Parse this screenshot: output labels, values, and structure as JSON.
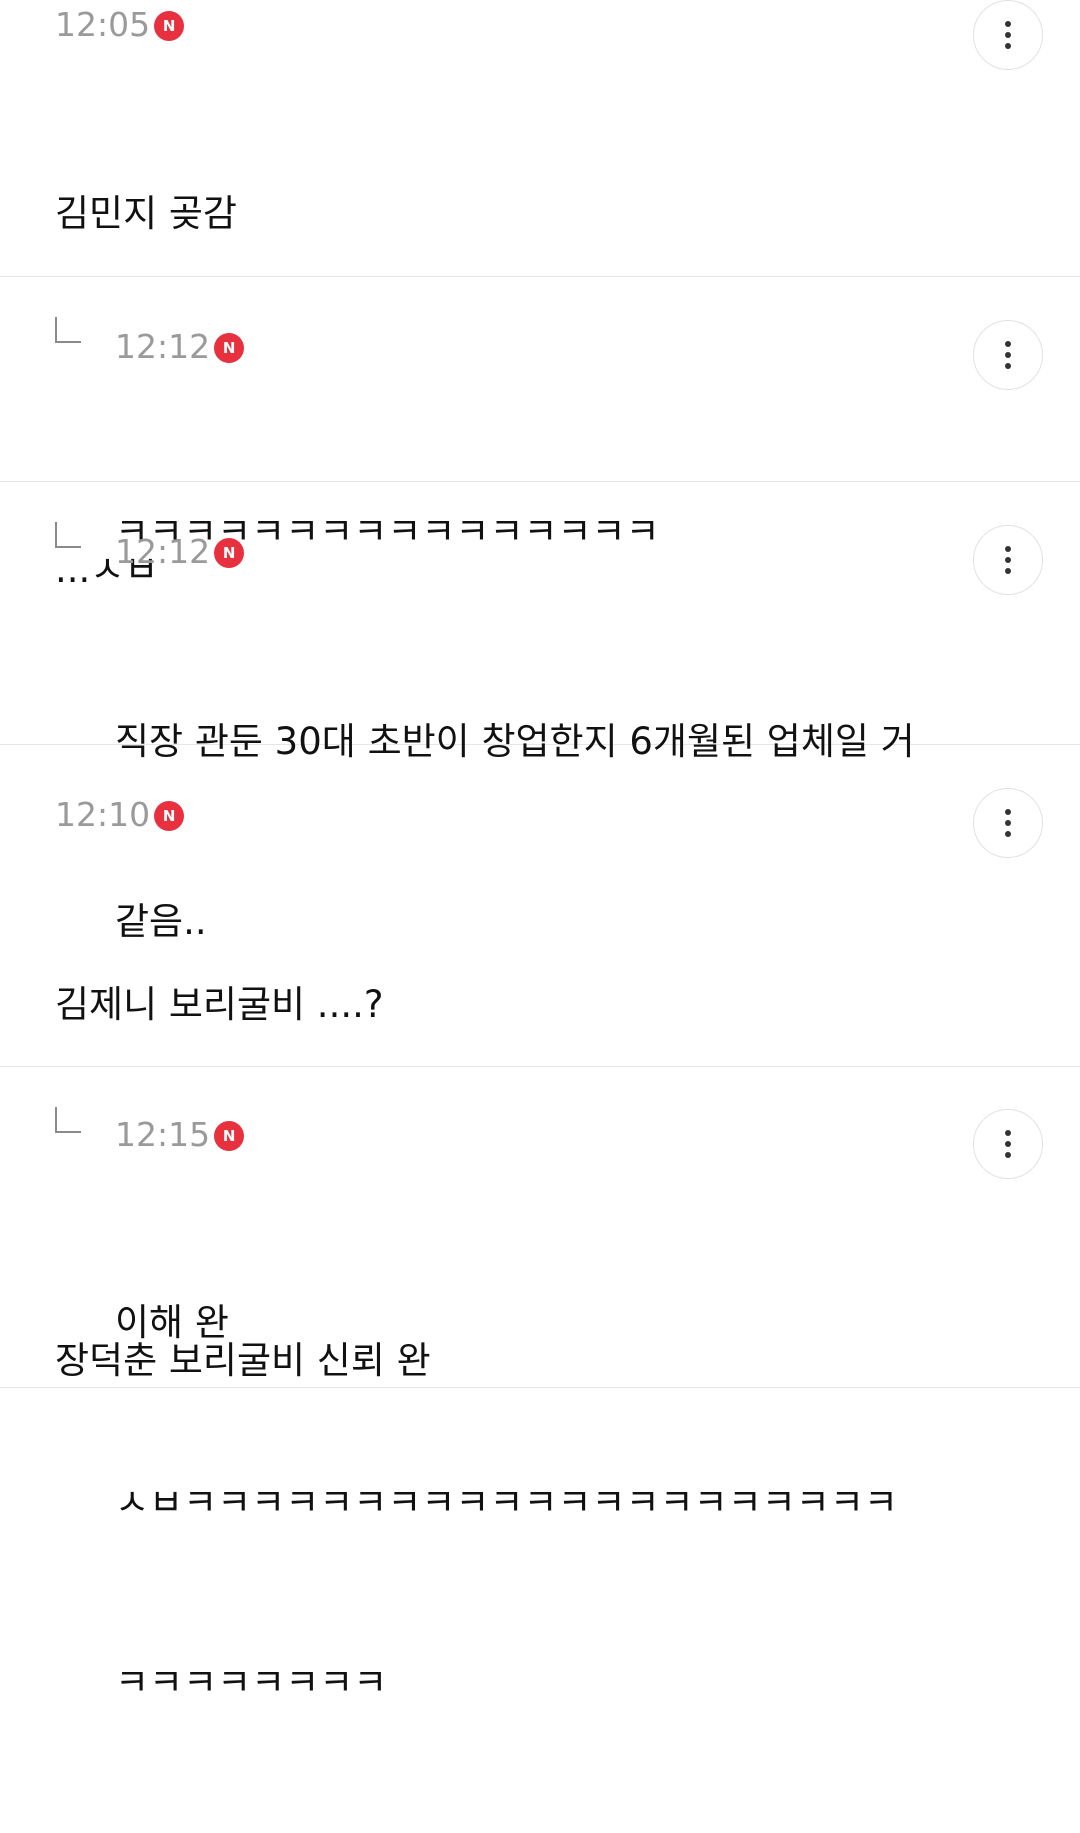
{
  "comments": [
    {
      "time": "12:05",
      "badge": "N",
      "is_reply": false,
      "lines": [
        "김민지 곶감",
        "",
        "...ㅅㅂ"
      ]
    },
    {
      "time": "12:12",
      "badge": "N",
      "is_reply": true,
      "lines": [
        "ㅋㅋㅋㅋㅋㅋㅋㅋㅋㅋㅋㅋㅋㅋㅋㅋ"
      ]
    },
    {
      "time": "12:12",
      "badge": "N",
      "is_reply": true,
      "lines": [
        "직장 관둔 30대 초반이 창업한지 6개월된 업체일 거",
        "같음.."
      ]
    },
    {
      "time": "12:10",
      "badge": "N",
      "is_reply": false,
      "lines": [
        "김제니 보리굴비 ....?",
        "",
        "장덕춘 보리굴비 신뢰 완"
      ]
    },
    {
      "time": "12:15",
      "badge": "N",
      "is_reply": true,
      "lines": [
        "이해 완",
        "ㅅㅂㅋㅋㅋㅋㅋㅋㅋㅋㅋㅋㅋㅋㅋㅋㅋㅋㅋㅋㅋㅋㅋ",
        "ㅋㅋㅋㅋㅋㅋㅋㅋ"
      ]
    }
  ],
  "colors": {
    "badge": "#e8313f",
    "time": "#9a9a9a",
    "divider": "#e6e6e6"
  },
  "icons": {
    "reply": "reply-arrow-icon",
    "more": "more-vertical-icon"
  }
}
